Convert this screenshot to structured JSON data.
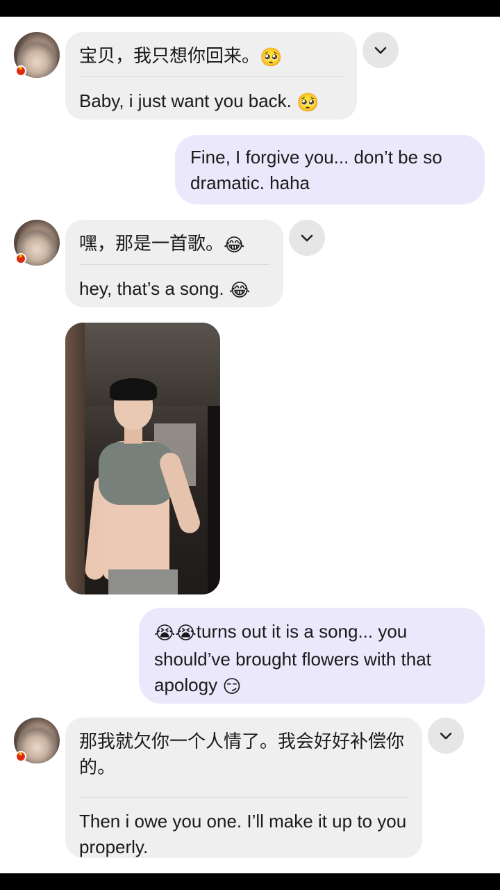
{
  "colors": {
    "incoming_bubble": "#efefef",
    "outgoing_bubble": "#ebe8fb",
    "chevron_button": "#e6e6e6"
  },
  "messages": [
    {
      "direction": "incoming",
      "original": "宝贝，我只想你回来。",
      "original_emoji": "🥺",
      "translation": "Baby, i just want you back.",
      "translation_emoji": "🥺"
    },
    {
      "direction": "outgoing",
      "text": "Fine, I forgive you... don’t be so dramatic. haha"
    },
    {
      "direction": "incoming",
      "original": "嘿，那是一首歌。",
      "original_emoji": "😂",
      "translation": "hey, that’s a song.",
      "translation_emoji": "😂"
    },
    {
      "direction": "incoming",
      "type": "photo"
    },
    {
      "direction": "outgoing",
      "prefix_emoji": "😭😭",
      "text": "turns out it is a song... you should’ve brought flowers with that apology",
      "suffix_emoji": "😏"
    },
    {
      "direction": "incoming",
      "original": "那我就欠你一个人情了。我会好好补偿你的。",
      "translation": "Then i owe you one. I’ll make it up to you properly."
    }
  ],
  "icons": {
    "avatar": "avatar",
    "flag": "china-flag-icon",
    "chevron": "chevron-down-icon"
  }
}
